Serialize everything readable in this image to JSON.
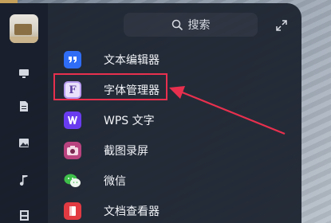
{
  "search": {
    "label": "搜索"
  },
  "apps": [
    {
      "name": "text-editor",
      "label": "文本编辑器",
      "icon": "quote-icon",
      "color": "#2f6df6"
    },
    {
      "name": "font-manager",
      "label": "字体管理器",
      "icon": "font-f-icon",
      "color": "#b79cf0"
    },
    {
      "name": "wps-writer",
      "label": "WPS 文字",
      "icon": "wps-w-icon",
      "color": "#6a3cf0"
    },
    {
      "name": "screenshot-recorder",
      "label": "截图录屏",
      "icon": "camera-icon",
      "color": "#b9437f"
    },
    {
      "name": "wechat",
      "label": "微信",
      "icon": "wechat-icon",
      "color": "#3fbf4a"
    },
    {
      "name": "document-viewer",
      "label": "文档查看器",
      "icon": "document-icon",
      "color": "#e23a42"
    }
  ],
  "sidebar": {
    "items": [
      {
        "name": "sidebar-item-computer",
        "icon": "monitor-icon"
      },
      {
        "name": "sidebar-item-documents",
        "icon": "document-icon"
      },
      {
        "name": "sidebar-item-pictures",
        "icon": "image-icon"
      },
      {
        "name": "sidebar-item-music",
        "icon": "music-note-icon"
      },
      {
        "name": "sidebar-item-videos",
        "icon": "film-icon"
      }
    ]
  },
  "annotation": {
    "color": "#e8304e"
  }
}
